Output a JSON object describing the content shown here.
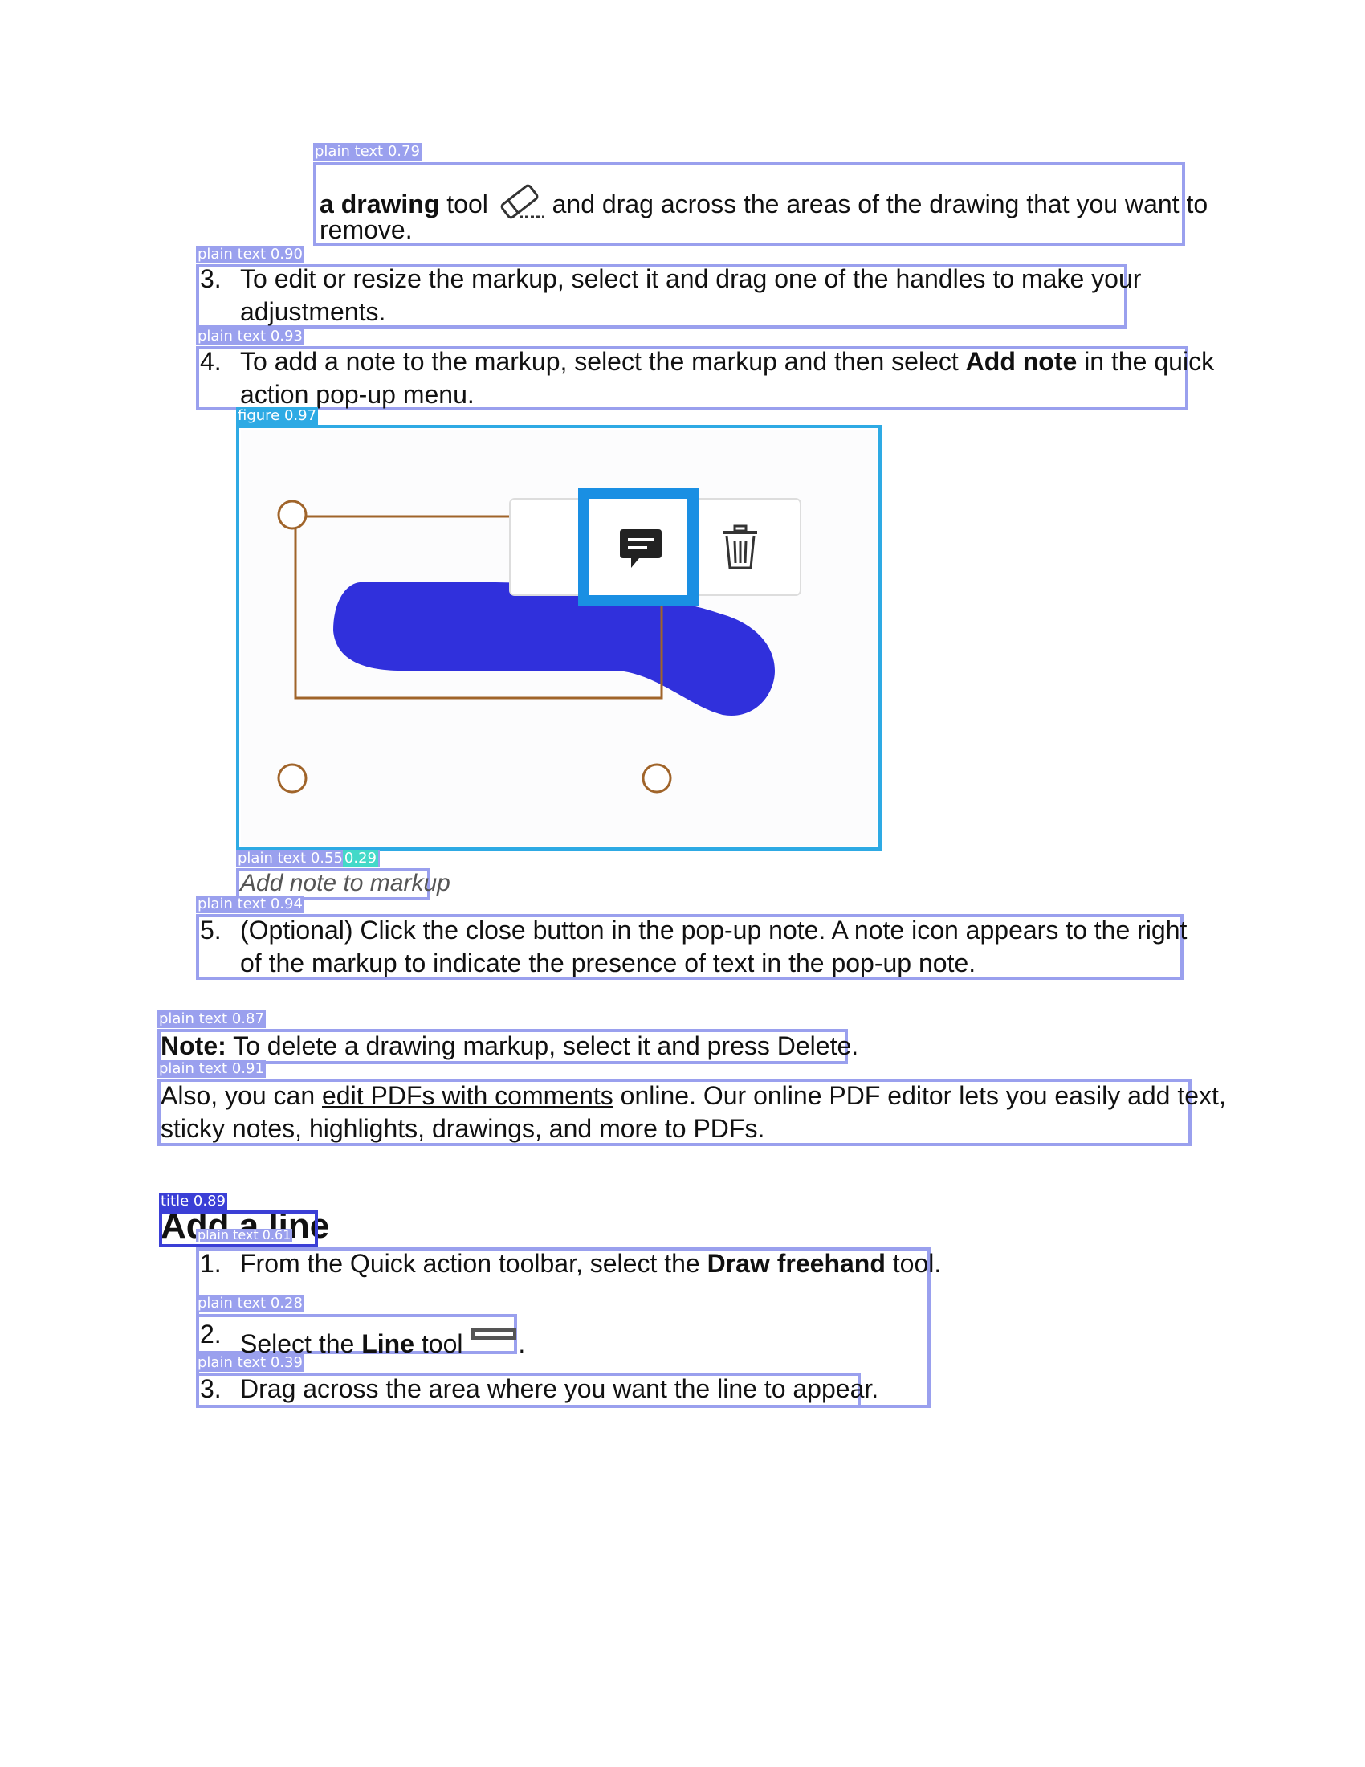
{
  "labels": {
    "plain_text_079": "plain text 0.79",
    "plain_text_090": "plain text 0.90",
    "plain_text_093": "plain text 0.93",
    "figure_097": "figure 0.97",
    "plain_text_055": "plain text 0.55",
    "plain_text_055_extra": "0.29",
    "plain_text_094": "plain text 0.94",
    "plain_text_087": "plain text 0.87",
    "plain_text_091": "plain text 0.91",
    "title_089": "title 0.89",
    "plain_text_061": "plain text 0.61",
    "plain_text_028": "plain text 0.28",
    "plain_text_039": "plain text 0.39"
  },
  "block1": {
    "bold": "a drawing",
    "pre_icon": " tool",
    "post_icon": " and drag across the areas of the drawing that you want to",
    "line2": "remove."
  },
  "step3": {
    "num": "3.",
    "line1": "To edit or resize the markup, select it and drag one of the handles to make your",
    "line2": "adjustments."
  },
  "step4": {
    "num": "4.",
    "pre": "To add a note to the markup, select the markup and then select ",
    "bold": "Add note",
    "post": " in the quick",
    "line2": "action pop-up menu."
  },
  "caption": "Add note to markup",
  "step5": {
    "num": "5.",
    "line1": "(Optional) Click the close button in the pop-up note. A note icon appears to the right",
    "line2": "of the markup to indicate the presence of text in the pop-up note."
  },
  "note": {
    "label": "Note:",
    "text": " To delete a drawing markup, select it and press Delete."
  },
  "also": {
    "pre": "Also, you can ",
    "link": "edit PDFs with comments",
    "post": " online. Our online PDF editor lets you easily add text,",
    "line2": "sticky notes, highlights, drawings, and more to PDFs."
  },
  "title": "Add a line",
  "line_steps": [
    {
      "num": "1.",
      "pre": "From the Quick action toolbar, select the ",
      "bold": "Draw freehand",
      "post": " tool."
    },
    {
      "num": "2.",
      "pre": "Select the ",
      "bold": "Line",
      "post": " tool",
      "tail": "."
    },
    {
      "num": "3.",
      "pre": "Drag across the area where you want the line to appear."
    }
  ],
  "figure": {
    "icons": [
      "comment-icon",
      "trash-icon",
      "eraser-icon",
      "line-tool-icon"
    ],
    "stroke_color": "#3333dd",
    "frame_color": "#a0642a",
    "highlight_color": "#1a8fe3"
  }
}
